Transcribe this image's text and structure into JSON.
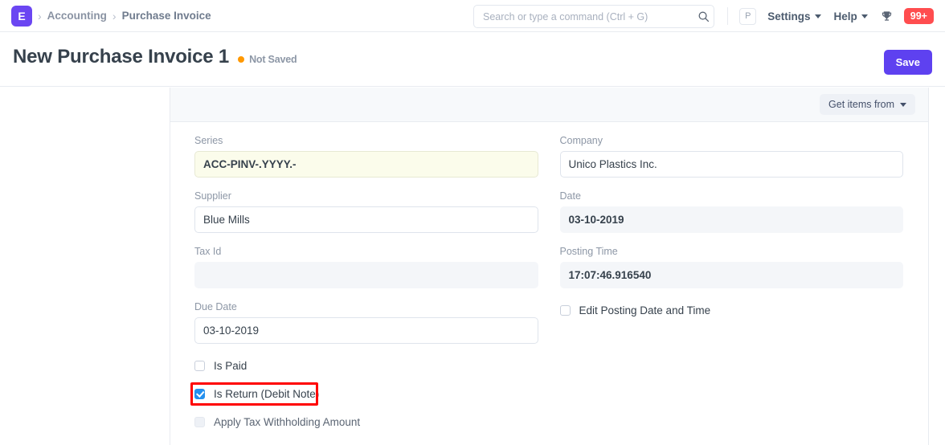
{
  "navbar": {
    "logo_letter": "E",
    "breadcrumbs": [
      {
        "label": "Accounting"
      },
      {
        "label": "Purchase Invoice"
      }
    ],
    "search": {
      "placeholder": "Search or type a command (Ctrl + G)",
      "value": ""
    },
    "avatar_letter": "P",
    "settings_label": "Settings",
    "help_label": "Help",
    "notification_count": "99+"
  },
  "page_head": {
    "title": "New Purchase Invoice 1",
    "status_text": "Not Saved",
    "status_color": "#ff9800",
    "save_label": "Save"
  },
  "toolbar": {
    "get_items_label": "Get items from"
  },
  "form": {
    "left": {
      "series": {
        "label": "Series",
        "value": "ACC-PINV-.YYYY.-",
        "bg_color": "#fbfceb"
      },
      "supplier": {
        "label": "Supplier",
        "value": "Blue Mills"
      },
      "tax_id": {
        "label": "Tax Id",
        "value": ""
      },
      "due_date": {
        "label": "Due Date",
        "value": "03-10-2019"
      },
      "checkboxes": [
        {
          "label": "Is Paid",
          "checked": false,
          "disabled": false
        },
        {
          "label": "Is Return (Debit Note)",
          "checked": true,
          "disabled": false
        },
        {
          "label": "Apply Tax Withholding Amount",
          "checked": false,
          "disabled": true
        }
      ]
    },
    "right": {
      "company": {
        "label": "Company",
        "value": "Unico Plastics Inc."
      },
      "date": {
        "label": "Date",
        "value": "03-10-2019"
      },
      "posting_time": {
        "label": "Posting Time",
        "value": "17:07:46.916540"
      },
      "edit_posting": {
        "label": "Edit Posting Date and Time",
        "checked": false
      }
    }
  },
  "highlight": {
    "color": "#ff0000",
    "target": "Is Return (Debit Note)"
  }
}
